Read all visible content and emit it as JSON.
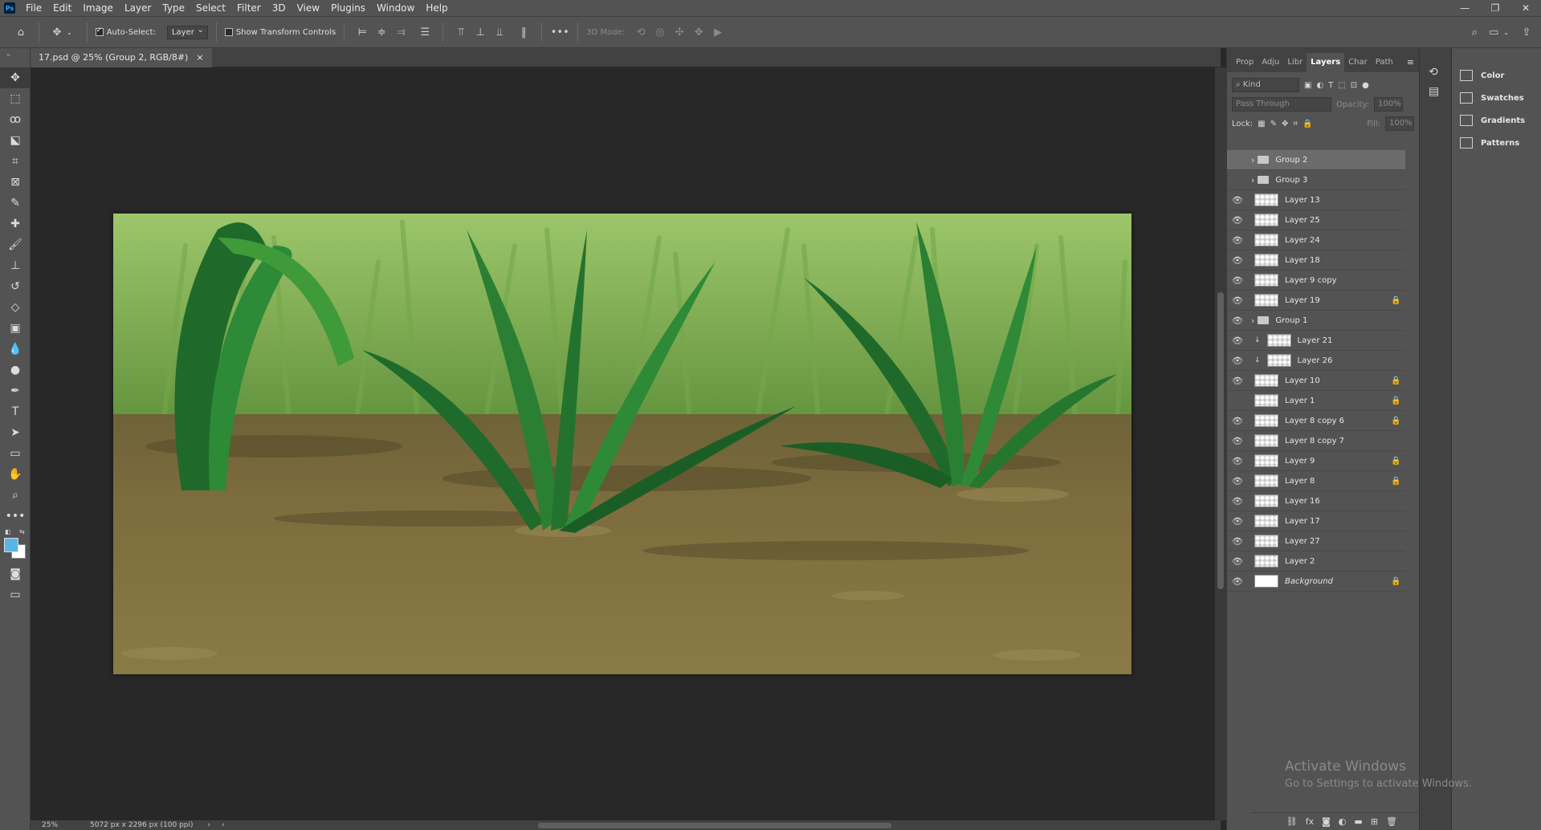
{
  "app": {
    "logo": "Ps"
  },
  "menu": [
    "File",
    "Edit",
    "Image",
    "Layer",
    "Type",
    "Select",
    "Filter",
    "3D",
    "View",
    "Plugins",
    "Window",
    "Help"
  ],
  "options": {
    "auto_select_label": "Auto-Select:",
    "auto_select_value": "Layer",
    "show_transform_label": "Show Transform Controls",
    "mode_3d_label": "3D Mode:",
    "more": "•••"
  },
  "document": {
    "tab_title": "17.psd @ 25% (Group 2, RGB/8#)",
    "tab_close": "×",
    "zoom": "25%",
    "dimensions": "5072 px x 2296 px (100 ppi)"
  },
  "panel_tabs": [
    "Prop",
    "Adju",
    "Libr",
    "Layers",
    "Char",
    "Path"
  ],
  "layers_panel": {
    "filter_kind": "Kind",
    "blend_mode": "Pass Through",
    "opacity_label": "Opacity:",
    "opacity_value": "100%",
    "lock_label": "Lock:",
    "fill_label": "Fill:",
    "fill_value": "100%",
    "layers": [
      {
        "name": "Group 2",
        "type": "group",
        "visible": false,
        "selected": true,
        "locked": false
      },
      {
        "name": "Group 3",
        "type": "group",
        "visible": false,
        "selected": false,
        "locked": false
      },
      {
        "name": "Layer 13",
        "type": "layer",
        "visible": true,
        "locked": false
      },
      {
        "name": "Layer 25",
        "type": "layer",
        "visible": true,
        "locked": false
      },
      {
        "name": "Layer 24",
        "type": "layer",
        "visible": true,
        "locked": false
      },
      {
        "name": "Layer 18",
        "type": "layer",
        "visible": true,
        "locked": false
      },
      {
        "name": "Layer 9 copy",
        "type": "layer",
        "visible": true,
        "locked": false
      },
      {
        "name": "Layer 19",
        "type": "layer",
        "visible": true,
        "locked": true
      },
      {
        "name": "Group 1",
        "type": "group",
        "visible": true,
        "locked": false
      },
      {
        "name": "Layer 21",
        "type": "clipped",
        "visible": true,
        "locked": false
      },
      {
        "name": "Layer 26",
        "type": "clipped",
        "visible": true,
        "locked": false
      },
      {
        "name": "Layer 10",
        "type": "layer",
        "visible": true,
        "locked": true
      },
      {
        "name": "Layer 1",
        "type": "layer",
        "visible": false,
        "locked": true
      },
      {
        "name": "Layer 8 copy 6",
        "type": "layer",
        "visible": true,
        "locked": true
      },
      {
        "name": "Layer 8 copy 7",
        "type": "layer",
        "visible": true,
        "locked": false
      },
      {
        "name": "Layer 9",
        "type": "layer",
        "visible": true,
        "locked": true
      },
      {
        "name": "Layer 8",
        "type": "layer",
        "visible": true,
        "locked": true
      },
      {
        "name": "Layer 16",
        "type": "layer",
        "visible": true,
        "locked": false
      },
      {
        "name": "Layer 17",
        "type": "layer",
        "visible": true,
        "locked": false
      },
      {
        "name": "Layer 27",
        "type": "layer",
        "visible": true,
        "locked": false
      },
      {
        "name": "Layer 2",
        "type": "layer",
        "visible": true,
        "locked": false
      },
      {
        "name": "Background",
        "type": "background",
        "visible": true,
        "locked": true
      }
    ]
  },
  "dock": [
    "Color",
    "Swatches",
    "Gradients",
    "Patterns"
  ],
  "watermark": {
    "line1": "Activate Windows",
    "line2": "Go to Settings to activate Windows."
  },
  "colors": {
    "foreground": "#5ab4e6",
    "background": "#ffffff",
    "accent": "#31a8ff"
  }
}
